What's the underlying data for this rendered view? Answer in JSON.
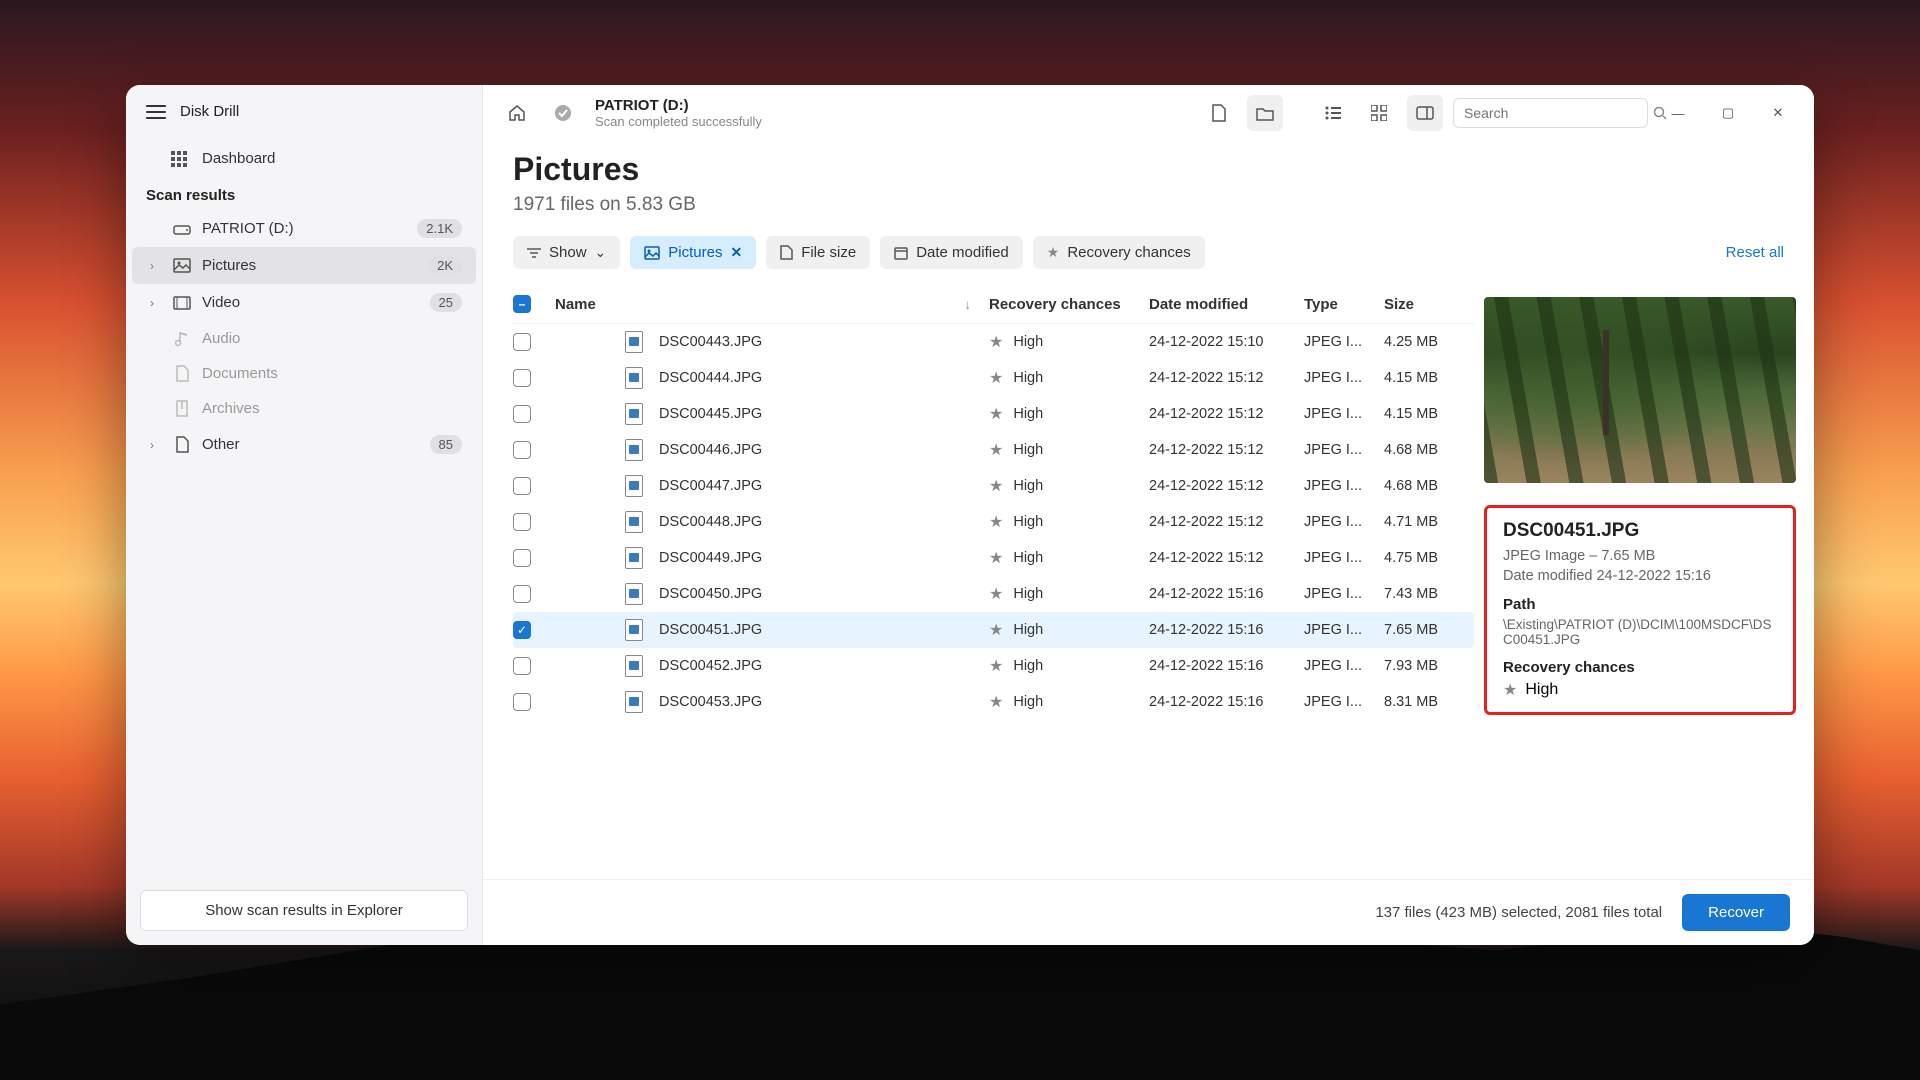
{
  "app_name": "Disk Drill",
  "sidebar": {
    "dashboard": "Dashboard",
    "section": "Scan results",
    "drive": {
      "label": "PATRIOT (D:)",
      "badge": "2.1K"
    },
    "categories": [
      {
        "label": "Pictures",
        "badge": "2K",
        "active": true,
        "icon": "image"
      },
      {
        "label": "Video",
        "badge": "25",
        "active": false,
        "icon": "video"
      },
      {
        "label": "Audio",
        "badge": "",
        "active": false,
        "muted": true,
        "icon": "audio"
      },
      {
        "label": "Documents",
        "badge": "",
        "active": false,
        "muted": true,
        "icon": "doc"
      },
      {
        "label": "Archives",
        "badge": "",
        "active": false,
        "muted": true,
        "icon": "archive"
      },
      {
        "label": "Other",
        "badge": "85",
        "active": false,
        "icon": "other"
      }
    ],
    "footer_button": "Show scan results in Explorer"
  },
  "topbar": {
    "title": "PATRIOT (D:)",
    "subtitle": "Scan completed successfully",
    "search_placeholder": "Search"
  },
  "page": {
    "title": "Pictures",
    "subtitle": "1971 files on 5.83 GB"
  },
  "filters": {
    "show": "Show",
    "pictures": "Pictures",
    "file_size": "File size",
    "date_modified": "Date modified",
    "recovery_chances": "Recovery chances",
    "reset": "Reset all"
  },
  "columns": {
    "name": "Name",
    "recovery": "Recovery chances",
    "date": "Date modified",
    "type": "Type",
    "size": "Size"
  },
  "rows": [
    {
      "name": "DSC00443.JPG",
      "recovery": "High",
      "date": "24-12-2022 15:10",
      "type": "JPEG I...",
      "size": "4.25 MB",
      "checked": false
    },
    {
      "name": "DSC00444.JPG",
      "recovery": "High",
      "date": "24-12-2022 15:12",
      "type": "JPEG I...",
      "size": "4.15 MB",
      "checked": false
    },
    {
      "name": "DSC00445.JPG",
      "recovery": "High",
      "date": "24-12-2022 15:12",
      "type": "JPEG I...",
      "size": "4.15 MB",
      "checked": false
    },
    {
      "name": "DSC00446.JPG",
      "recovery": "High",
      "date": "24-12-2022 15:12",
      "type": "JPEG I...",
      "size": "4.68 MB",
      "checked": false
    },
    {
      "name": "DSC00447.JPG",
      "recovery": "High",
      "date": "24-12-2022 15:12",
      "type": "JPEG I...",
      "size": "4.68 MB",
      "checked": false
    },
    {
      "name": "DSC00448.JPG",
      "recovery": "High",
      "date": "24-12-2022 15:12",
      "type": "JPEG I...",
      "size": "4.71 MB",
      "checked": false
    },
    {
      "name": "DSC00449.JPG",
      "recovery": "High",
      "date": "24-12-2022 15:12",
      "type": "JPEG I...",
      "size": "4.75 MB",
      "checked": false
    },
    {
      "name": "DSC00450.JPG",
      "recovery": "High",
      "date": "24-12-2022 15:16",
      "type": "JPEG I...",
      "size": "7.43 MB",
      "checked": false
    },
    {
      "name": "DSC00451.JPG",
      "recovery": "High",
      "date": "24-12-2022 15:16",
      "type": "JPEG I...",
      "size": "7.65 MB",
      "checked": true
    },
    {
      "name": "DSC00452.JPG",
      "recovery": "High",
      "date": "24-12-2022 15:16",
      "type": "JPEG I...",
      "size": "7.93 MB",
      "checked": false
    },
    {
      "name": "DSC00453.JPG",
      "recovery": "High",
      "date": "24-12-2022 15:16",
      "type": "JPEG I...",
      "size": "8.31 MB",
      "checked": false
    }
  ],
  "preview": {
    "filename": "DSC00451.JPG",
    "type_size": "JPEG Image – 7.65 MB",
    "date_line": "Date modified 24-12-2022 15:16",
    "path_label": "Path",
    "path_value": "\\Existing\\PATRIOT (D)\\DCIM\\100MSDCF\\DSC00451.JPG",
    "recovery_label": "Recovery chances",
    "recovery_value": "High"
  },
  "footer": {
    "status": "137 files (423 MB) selected, 2081 files total",
    "recover": "Recover"
  }
}
